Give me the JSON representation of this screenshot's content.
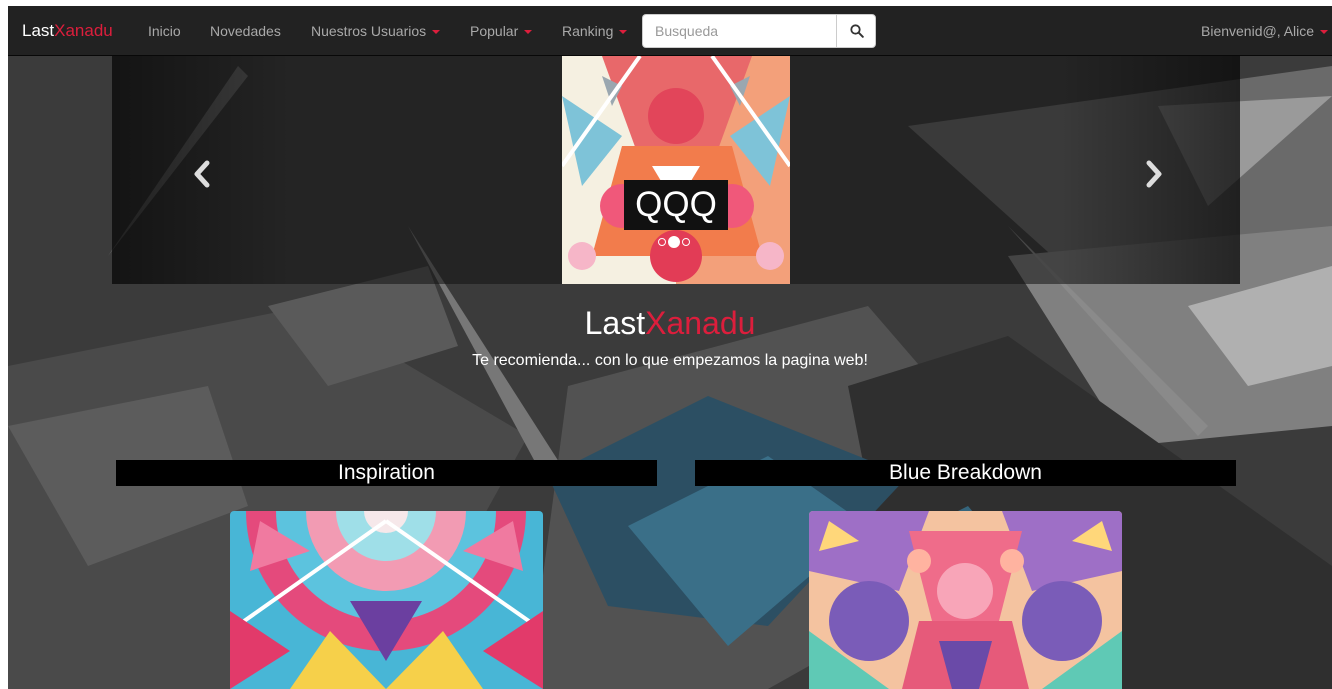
{
  "navbar": {
    "brand_part1": "Last",
    "brand_part2": "Xanadu",
    "links": {
      "inicio": "Inicio",
      "novedades": "Novedades",
      "usuarios": "Nuestros Usuarios",
      "popular": "Popular",
      "ranking": "Ranking"
    },
    "search_placeholder": "Busqueda",
    "user_menu": "Bienvenid@, Alice"
  },
  "carousel": {
    "caption": "QQQ",
    "slide_count": 3,
    "active_index": 1
  },
  "hero": {
    "title_part1": "Last",
    "title_part2": "Xanadu",
    "subtitle": "Te recomienda... con lo que empezamos la pagina web!"
  },
  "cards": [
    {
      "title": "Inspiration",
      "image_icon": "kaleidoscope-art"
    },
    {
      "title": "Blue Breakdown",
      "image_icon": "kaleidoscope-art"
    }
  ],
  "colors": {
    "accent": "#dc1e3c",
    "navbar_bg": "#222222",
    "nav_text": "#a9a9a9"
  }
}
